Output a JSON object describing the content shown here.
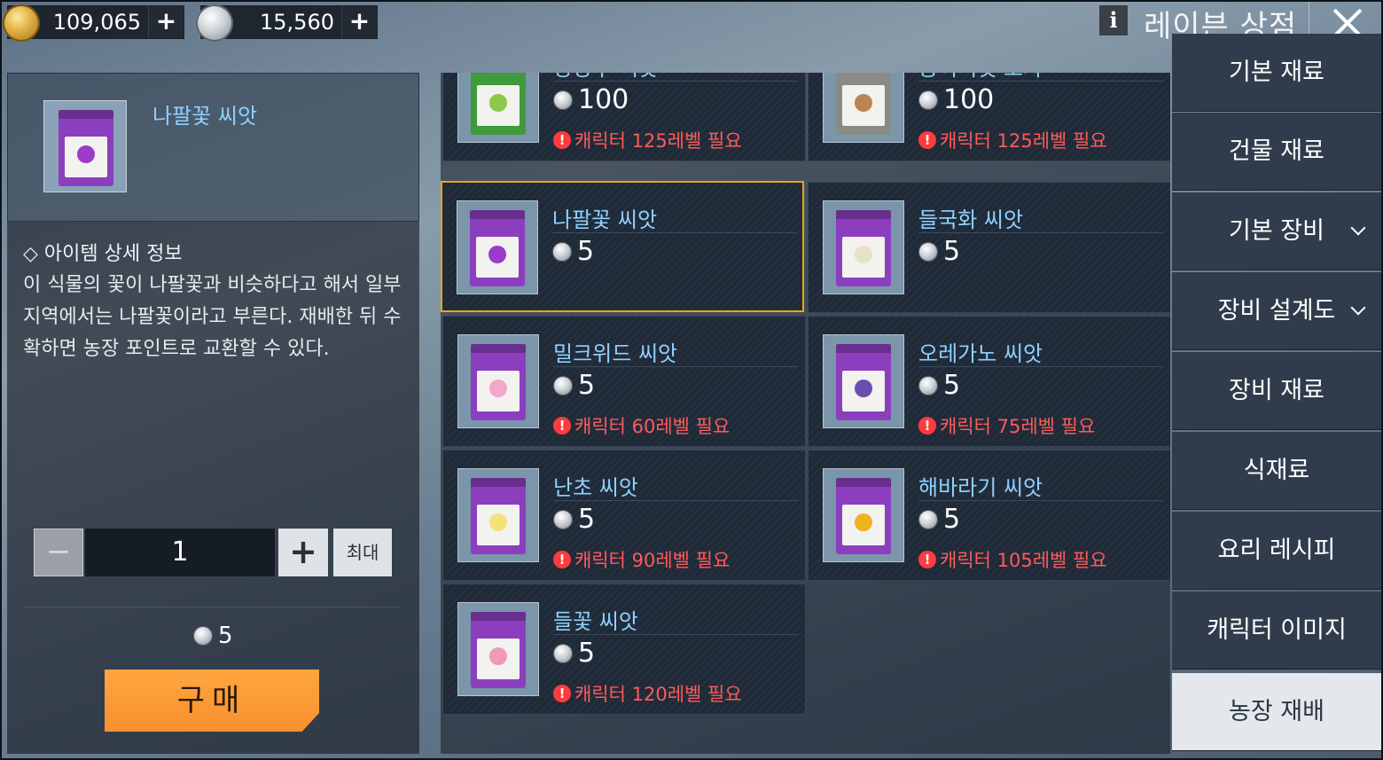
{
  "topbar": {
    "gold": {
      "icon": "gold-coin-icon",
      "amount": "109,065",
      "add": "+"
    },
    "silver": {
      "icon": "silver-coin-icon",
      "amount": "15,560",
      "add": "+"
    },
    "info": "i",
    "title": "레이븐 상점",
    "close_icon": "close-icon"
  },
  "detail": {
    "item_name": "나팔꽃 씨앗",
    "section_title": "◇ 아이템 상세 정보",
    "description": "이 식물의 꽃이 나팔꽃과 비슷하다고 해서 일부 지역에서는 나팔꽃이라고 부른다. 재배한 뒤 수확하면 농장 포인트로 교환할 수 있다.",
    "qty_minus": "−",
    "quantity": "1",
    "qty_plus": "+",
    "max_label": "최대",
    "total_price": "5",
    "buy_label": "구매"
  },
  "items": [
    {
      "name": "양상추 씨앗",
      "price": "100",
      "requirement": "캐릭터 125레벨 필요",
      "bag_color": "#3e9a3a",
      "flower_color": "#8cc84b"
    },
    {
      "name": "송이버섯 포자",
      "price": "100",
      "requirement": "캐릭터 125레벨 필요",
      "bag_color": "#8a8a86",
      "flower_color": "#b98653"
    },
    {
      "name": "나팔꽃 씨앗",
      "price": "5",
      "requirement": "",
      "bag_color": "#8b3fbf",
      "flower_color": "#9b3bc9"
    },
    {
      "name": "들국화 씨앗",
      "price": "5",
      "requirement": "",
      "bag_color": "#8b3fbf",
      "flower_color": "#e8e2c4"
    },
    {
      "name": "밀크위드 씨앗",
      "price": "5",
      "requirement": "캐릭터 60레벨 필요",
      "bag_color": "#8b3fbf",
      "flower_color": "#f2a8c8"
    },
    {
      "name": "오레가노 씨앗",
      "price": "5",
      "requirement": "캐릭터 75레벨 필요",
      "bag_color": "#8b3fbf",
      "flower_color": "#6a4fb0"
    },
    {
      "name": "난초 씨앗",
      "price": "5",
      "requirement": "캐릭터 90레벨 필요",
      "bag_color": "#8b3fbf",
      "flower_color": "#f1e27a"
    },
    {
      "name": "해바라기 씨앗",
      "price": "5",
      "requirement": "캐릭터 105레벨 필요",
      "bag_color": "#8b3fbf",
      "flower_color": "#f2b21c"
    },
    {
      "name": "들꽃 씨앗",
      "price": "5",
      "requirement": "캐릭터 120레벨 필요",
      "bag_color": "#8b3fbf",
      "flower_color": "#ef9ab8"
    }
  ],
  "categories": [
    {
      "label": "기본 재료",
      "chevron": false
    },
    {
      "label": "건물 재료",
      "chevron": false
    },
    {
      "label": "기본 장비",
      "chevron": true
    },
    {
      "label": "장비 설계도",
      "chevron": true
    },
    {
      "label": "장비 재료",
      "chevron": false
    },
    {
      "label": "식재료",
      "chevron": false
    },
    {
      "label": "요리 레시피",
      "chevron": false
    },
    {
      "label": "캐릭터 이미지",
      "chevron": false
    },
    {
      "label": "농장 재배",
      "chevron": false,
      "active": true
    }
  ],
  "colors": {
    "accent_orange": "#f7902b",
    "selected_border": "#e6a51f",
    "name_blue": "#8fd1ff",
    "requirement_red": "#ff5a5a"
  }
}
